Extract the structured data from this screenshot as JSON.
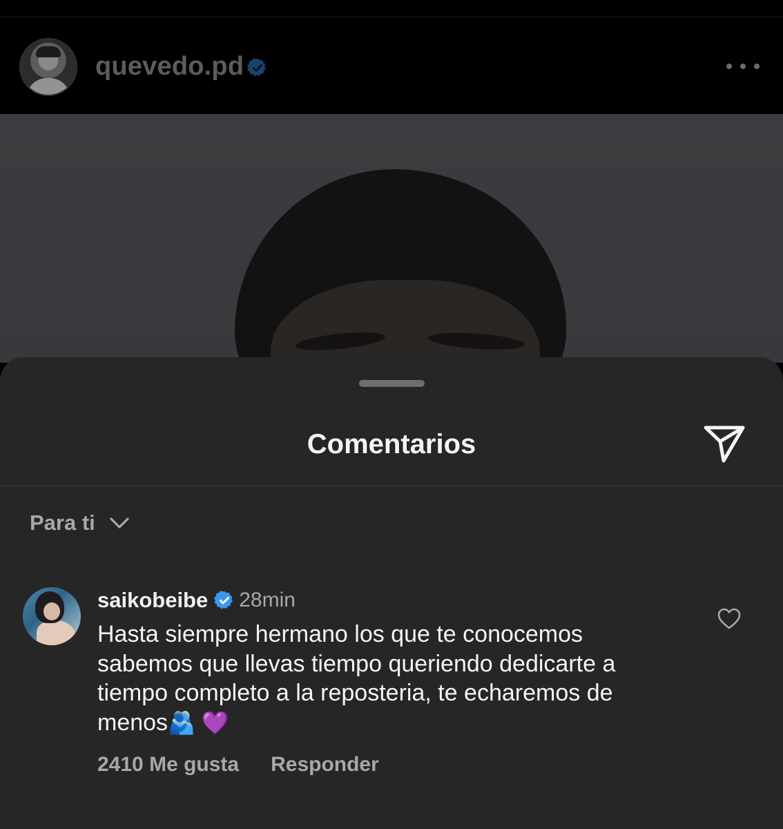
{
  "post": {
    "username": "quevedo.pd",
    "more_icon": "more-horizontal-icon"
  },
  "comments_sheet": {
    "title": "Comentarios",
    "share_icon": "send-icon",
    "sort": {
      "label": "Para ti",
      "icon": "chevron-down-icon"
    },
    "comments": [
      {
        "username": "saikobeibe",
        "time": "28min",
        "text": "Hasta siempre hermano los que te conocemos sabemos que llevas tiempo queriendo dedicarte a tiempo completo a la reposteria, te echaremos de menos",
        "emojis": "🫂 💜",
        "likes": "2410 Me gusta",
        "reply_label": "Responder",
        "like_icon": "heart-outline-icon"
      }
    ]
  },
  "colors": {
    "verified": "#3897f0",
    "sheet_background": "#262626",
    "secondary_text": "#a8a8a8"
  }
}
